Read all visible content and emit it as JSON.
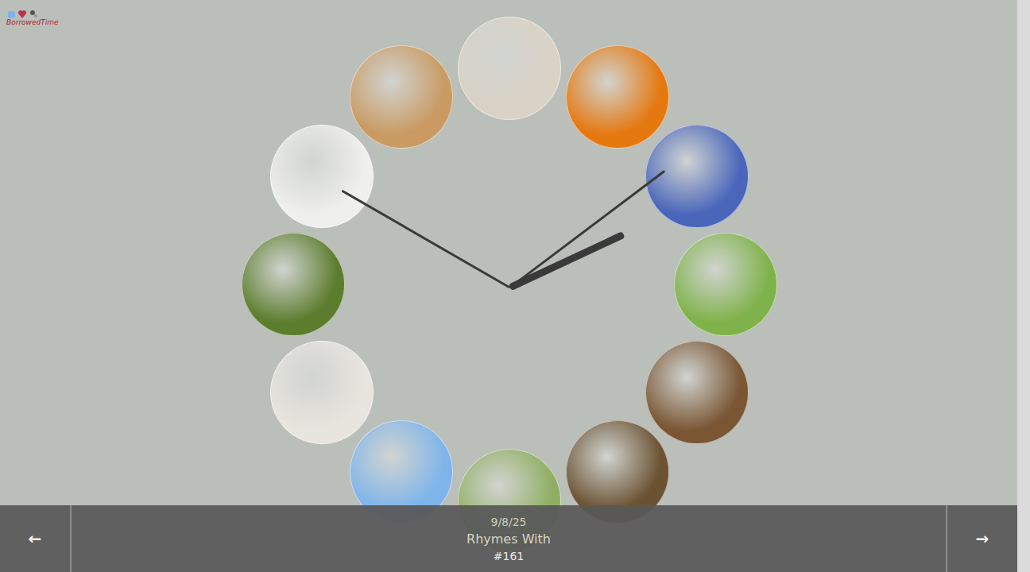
{
  "logo": {
    "text": "BorrowedTime"
  },
  "tiles": [
    {
      "color": "#d9d2c6"
    },
    {
      "color": "#e5780f"
    },
    {
      "color": "#4a66bb"
    },
    {
      "color": "#7fb24a"
    },
    {
      "color": "#7a5634"
    },
    {
      "color": "#6b5232"
    },
    {
      "color": "#8fae62"
    },
    {
      "color": "#7fb4ea"
    },
    {
      "color": "#e8e4de"
    },
    {
      "color": "#5d7d2e"
    },
    {
      "color": "#efefed"
    },
    {
      "color": "#c99a62"
    }
  ],
  "clock": {
    "hour_angle": 65,
    "minute_angle": 53,
    "second_angle": 300
  },
  "footer": {
    "prev_icon": "←",
    "next_icon": "→",
    "date": "9/8/25",
    "title": "Rhymes With",
    "number": "#161"
  }
}
